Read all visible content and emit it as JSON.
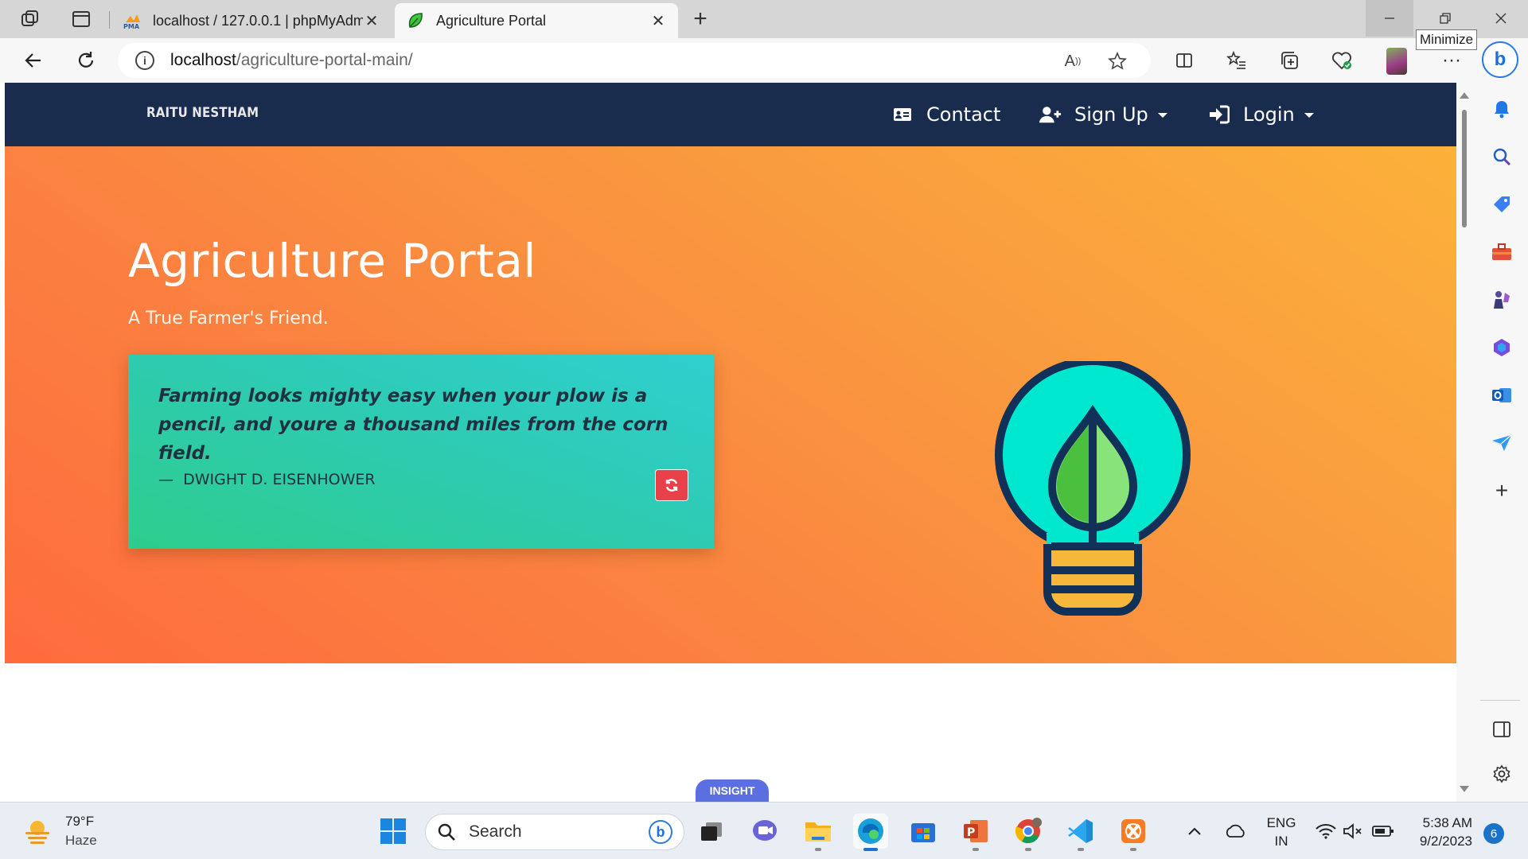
{
  "browser": {
    "tabs": [
      {
        "title": "localhost / 127.0.0.1 | phpMyAdmin",
        "favicon": "phpmyadmin-icon",
        "favicon_label": "PMA"
      },
      {
        "title": "Agriculture Portal",
        "favicon": "leaf-icon"
      }
    ],
    "tooltip": "Minimize",
    "address": {
      "host": "localhost",
      "path": "/agriculture-portal-main/"
    }
  },
  "site": {
    "brand": "RAITU NESTHAM",
    "nav": {
      "contact": "Contact",
      "signup": "Sign Up",
      "login": "Login"
    },
    "hero": {
      "title": "Agriculture Portal",
      "subtitle": "A True Farmer's Friend.",
      "quote": "Farming looks mighty easy when your plow is a pencil, and youre a thousand miles from the corn field.",
      "author_dash": "—",
      "author": "DWIGHT D. EISENHOWER"
    },
    "insight_tag": "INSIGHT"
  },
  "colors": {
    "navbar": "#192c4e",
    "hero_gradient": [
      "#fcb13a",
      "#fe6b3e"
    ],
    "quote_card": [
      "#2fcfcf",
      "#2dcc8c"
    ],
    "refresh_button": "#e8414a",
    "bulb_fill": "#00e7cf",
    "bulb_outline": "#123158",
    "leaf_dark": "#4bbf3e",
    "leaf_light": "#88e37a",
    "bulb_base": "#f6b83b"
  },
  "taskbar": {
    "weather": {
      "temp": "79°F",
      "condition": "Haze"
    },
    "search_placeholder": "Search",
    "language": {
      "line1": "ENG",
      "line2": "IN"
    },
    "clock": {
      "time": "5:38 AM",
      "date": "9/2/2023"
    },
    "notifications": "6"
  }
}
